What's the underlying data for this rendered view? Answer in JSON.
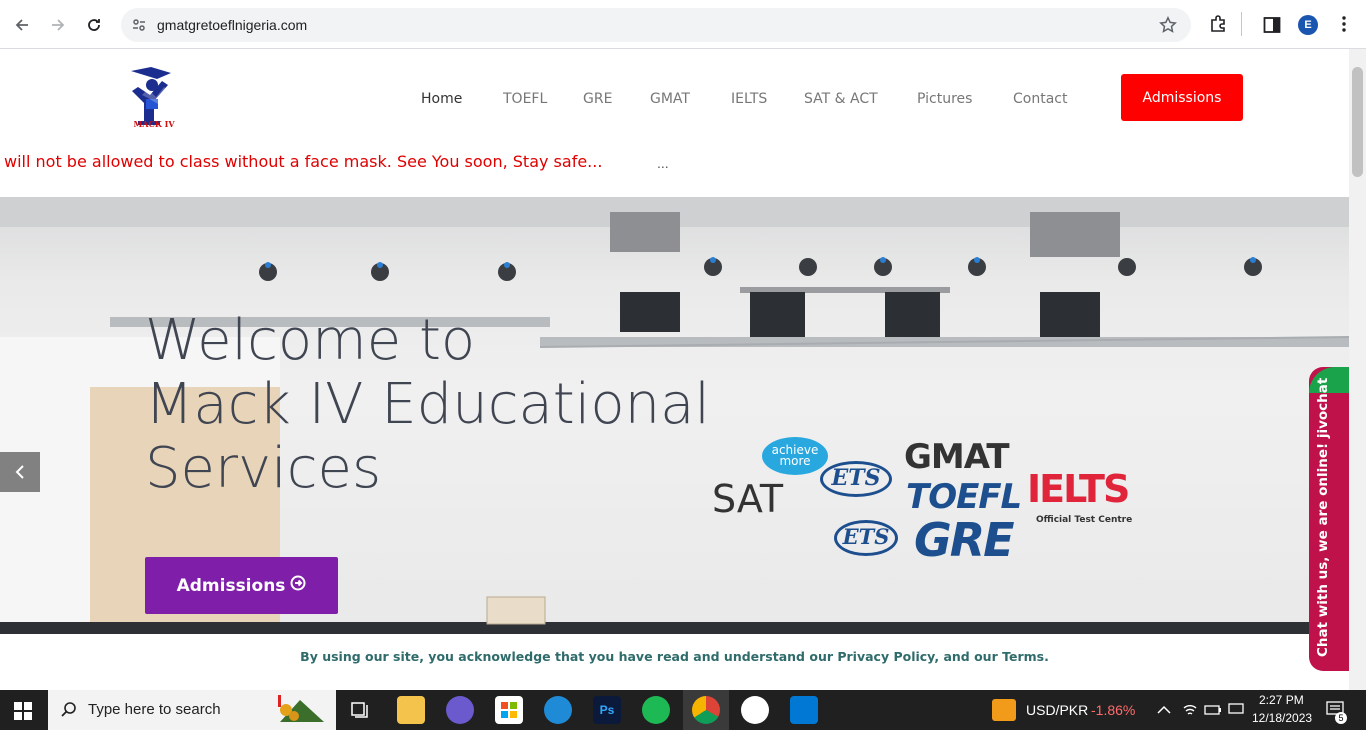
{
  "browser": {
    "url": "gmatgretoeflnigeria.com",
    "profile_initial": "E"
  },
  "site": {
    "logo_text": "MACK IV",
    "nav": [
      "Home",
      "TOEFL",
      "GRE",
      "GMAT",
      "IELTS",
      "SAT & ACT",
      "Pictures",
      "Contact"
    ],
    "admissions_top": "Admissions",
    "ticker": "will not be allowed to class without a face mask. See You soon, Stay safe...",
    "ticker_more": "...",
    "hero": {
      "title_line1": "Welcome to",
      "title_line2": "Mack IV Educational",
      "title_line3": "Services",
      "button": "Admissions",
      "logos": {
        "achieve": "achieve more",
        "sat": "SAT",
        "ets": "ETS",
        "gmat": "GMAT",
        "toefl": "TOEFL",
        "ielts": "IELTS",
        "ielts_sub": "Official Test Centre",
        "gre": "GRE"
      }
    },
    "cookie_notice": "By using our site, you acknowledge that you have read and understand our Privacy Policy, and our Terms.",
    "chat": "Chat with us, we are online!  jivochat"
  },
  "taskbar": {
    "search_placeholder": "Type here to search",
    "currency": "USD/PKR",
    "currency_change": "-1.86%",
    "time": "2:27 PM",
    "date": "12/18/2023",
    "notifications": "5"
  },
  "colors": {
    "accent_red": "#ff0000",
    "accent_purple": "#7f1ea8",
    "chat_pink": "#c0124a"
  }
}
